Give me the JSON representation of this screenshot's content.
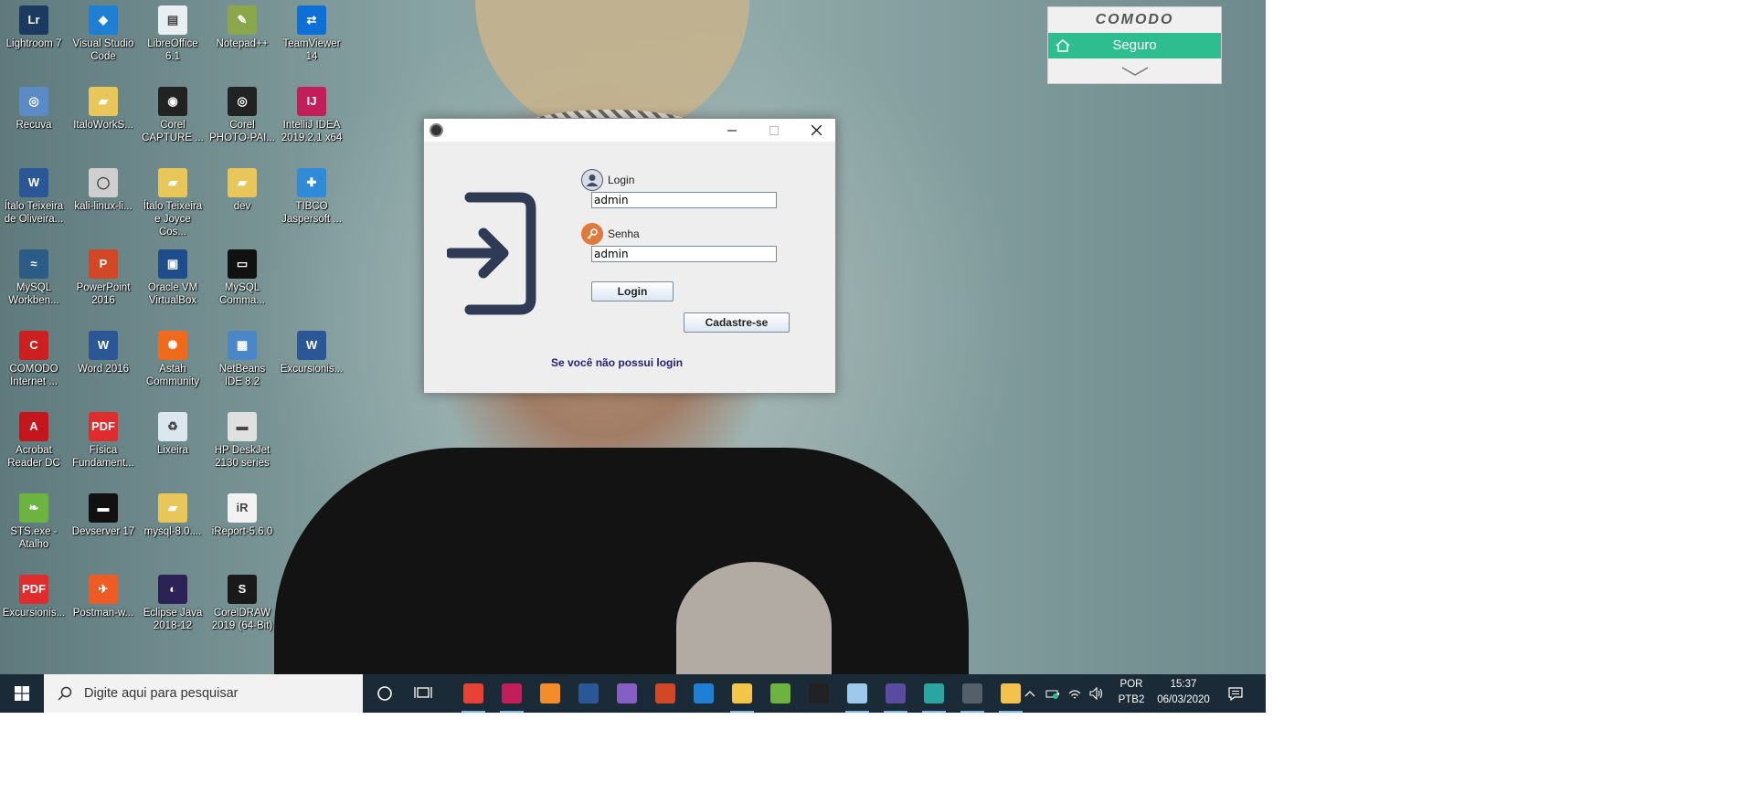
{
  "desktop_icons": [
    {
      "label": "Lightroom 7",
      "color": "#1c3a5f",
      "glyph": "Lr"
    },
    {
      "label": "Visual Studio Code",
      "color": "#1f7fd4",
      "glyph": "◆"
    },
    {
      "label": "LibreOffice 6.1",
      "color": "#e9eef2",
      "glyph": "▤"
    },
    {
      "label": "Notepad++",
      "color": "#8aa84b",
      "glyph": "✎"
    },
    {
      "label": "TeamViewer 14",
      "color": "#0e6fd6",
      "glyph": "⇄"
    },
    {
      "label": "Recuva",
      "color": "#5a8bc4",
      "glyph": "◎"
    },
    {
      "label": "ItaloWorkS...",
      "color": "#e8c65a",
      "glyph": "▰"
    },
    {
      "label": "Corel CAPTURE ...",
      "color": "#222222",
      "glyph": "◉"
    },
    {
      "label": "Corel PHOTO-PAI...",
      "color": "#222222",
      "glyph": "◎"
    },
    {
      "label": "IntelliJ IDEA 2019.2.1 x64",
      "color": "#c21f5a",
      "glyph": "IJ"
    },
    {
      "label": "Ítalo Teixeira de Oliveira...",
      "color": "#2b5797",
      "glyph": "W"
    },
    {
      "label": "kali-linux-li...",
      "color": "#cfcfcf",
      "glyph": "◯"
    },
    {
      "label": "Ítalo Teixeira e Joyce Cos...",
      "color": "#e8c65a",
      "glyph": "▰"
    },
    {
      "label": "dev",
      "color": "#e8c65a",
      "glyph": "▰"
    },
    {
      "label": "TIBCO Jaspersoft ...",
      "color": "#2f8ad8",
      "glyph": "✚"
    },
    {
      "label": "MySQL Workben...",
      "color": "#2a5c85",
      "glyph": "≈"
    },
    {
      "label": "PowerPoint 2016",
      "color": "#d24726",
      "glyph": "P"
    },
    {
      "label": "Oracle VM VirtualBox",
      "color": "#1e4d8c",
      "glyph": "▣"
    },
    {
      "label": "MySQL Comma...",
      "color": "#111111",
      "glyph": "▭"
    },
    {
      "label": "",
      "color": "",
      "glyph": ""
    },
    {
      "label": "COMODO Internet ...",
      "color": "#cc1f1f",
      "glyph": "C"
    },
    {
      "label": "Word 2016",
      "color": "#2b5797",
      "glyph": "W"
    },
    {
      "label": "Astah Community",
      "color": "#f06a1c",
      "glyph": "✺"
    },
    {
      "label": "NetBeans IDE 8.2",
      "color": "#4b86c8",
      "glyph": "▦"
    },
    {
      "label": "Excursionis...",
      "color": "#2b5797",
      "glyph": "W"
    },
    {
      "label": "Acrobat Reader DC",
      "color": "#c4161c",
      "glyph": "A"
    },
    {
      "label": "Física Fundament...",
      "color": "#e02c2c",
      "glyph": "PDF"
    },
    {
      "label": "Lixeira",
      "color": "#dbe6ee",
      "glyph": "♻"
    },
    {
      "label": "HP DeskJet 2130 series",
      "color": "#e0e0e0",
      "glyph": "▬"
    },
    {
      "label": "",
      "color": "",
      "glyph": ""
    },
    {
      "label": "STS.exe - Atalho",
      "color": "#6db33f",
      "glyph": "❧"
    },
    {
      "label": "Devserver 17",
      "color": "#111111",
      "glyph": "▬"
    },
    {
      "label": "mysql-8.0....",
      "color": "#e8c65a",
      "glyph": "▰"
    },
    {
      "label": "iReport-5.6.0",
      "color": "#f2f2f2",
      "glyph": "iR"
    },
    {
      "label": "",
      "color": "",
      "glyph": ""
    },
    {
      "label": "Excursionis...",
      "color": "#e02c2c",
      "glyph": "PDF"
    },
    {
      "label": "Postman-w...",
      "color": "#ef5b25",
      "glyph": "✈"
    },
    {
      "label": "Eclipse Java 2018-12",
      "color": "#2c2255",
      "glyph": "◐"
    },
    {
      "label": "CorelDRAW 2019 (64-Bit)",
      "color": "#1a1a1a",
      "glyph": "S"
    }
  ],
  "comodo_widget": {
    "brand": "COMODO",
    "status": "Seguro",
    "status_color": "#2ebd8f"
  },
  "login_window": {
    "login_label": "Login",
    "login_value": "admin",
    "password_label": "Senha",
    "password_value": "admin",
    "login_button": "Login",
    "no_account_text": "Se você não possui login",
    "register_button": "Cadastre-se",
    "icon_color": "#2f3a55"
  },
  "taskbar": {
    "search_placeholder": "Digite aqui para pesquisar",
    "language_line1": "POR",
    "language_line2": "PTB2",
    "time": "15:37",
    "date": "06/03/2020",
    "apps": [
      {
        "name": "chrome-app-icon",
        "color": "#e94235",
        "active": true
      },
      {
        "name": "intellij-app-icon",
        "color": "#c21f5a",
        "active": true
      },
      {
        "name": "sublime-app-icon",
        "color": "#f28d2a",
        "active": false
      },
      {
        "name": "word-app-icon",
        "color": "#2b5797",
        "active": false
      },
      {
        "name": "visual-studio-app-icon",
        "color": "#865fc5",
        "active": false
      },
      {
        "name": "powerpoint-app-icon",
        "color": "#d24726",
        "active": false
      },
      {
        "name": "vscode-app-icon",
        "color": "#1f7fd4",
        "active": false
      },
      {
        "name": "file-explorer-app-icon",
        "color": "#f3c648",
        "active": true
      },
      {
        "name": "sts-app-icon",
        "color": "#6db33f",
        "active": false
      },
      {
        "name": "devserver-app-icon",
        "color": "#222222",
        "active": false
      },
      {
        "name": "paint-app-icon",
        "color": "#9ec9ec",
        "active": true
      },
      {
        "name": "eclipse-app-icon",
        "color": "#5a4aa0",
        "active": true
      },
      {
        "name": "java-window-app-icon",
        "color": "#2aa5a0",
        "active": true
      },
      {
        "name": "login-app-taskbar-icon",
        "color": "#555f6b",
        "active": true
      },
      {
        "name": "git-app-icon",
        "color": "#f2c14e",
        "active": true
      }
    ]
  }
}
